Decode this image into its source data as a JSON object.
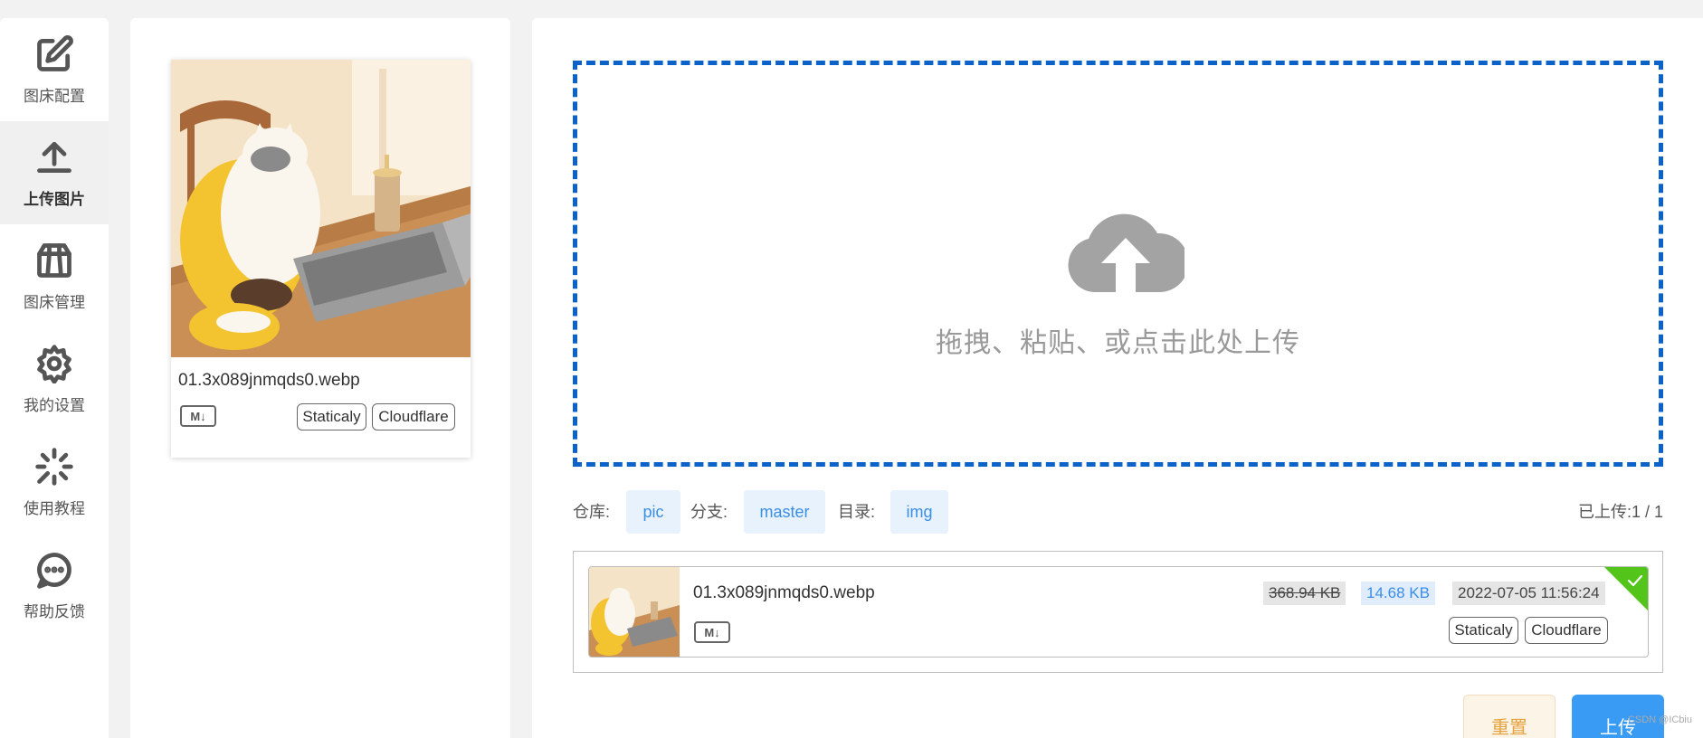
{
  "sidebar": {
    "items": [
      {
        "label": "图床配置",
        "icon": "edit-icon"
      },
      {
        "label": "上传图片",
        "icon": "upload-icon",
        "active": true
      },
      {
        "label": "图床管理",
        "icon": "package-icon"
      },
      {
        "label": "我的设置",
        "icon": "gear-icon"
      },
      {
        "label": "使用教程",
        "icon": "sparkle-icon"
      },
      {
        "label": "帮助反馈",
        "icon": "chat-icon"
      }
    ]
  },
  "gallery": {
    "card": {
      "filename": "01.3x089jnmqds0.webp",
      "md_label": "M↓",
      "tags": [
        "Staticaly",
        "Cloudflare"
      ]
    }
  },
  "dropzone": {
    "text": "拖拽、粘贴、或点击此处上传",
    "border_color": "#0b63c9"
  },
  "config": {
    "repo_label": "仓库:",
    "repo_value": "pic",
    "branch_label": "分支:",
    "branch_value": "master",
    "dir_label": "目录:",
    "dir_value": "img",
    "uploaded": "已上传:1 / 1"
  },
  "upload_item": {
    "filename": "01.3x089jnmqds0.webp",
    "md_label": "M↓",
    "original_size": "368.94 KB",
    "compressed_size": "14.68 KB",
    "timestamp": "2022-07-05 11:56:24",
    "tags": [
      "Staticaly",
      "Cloudflare"
    ],
    "status": "success"
  },
  "buttons": {
    "reset": "重置",
    "upload": "上传"
  },
  "watermark": "CSDN @ICbiu",
  "colors": {
    "accent": "#3a9bf5",
    "success": "#52c41a",
    "warning": "#e6a23c"
  }
}
